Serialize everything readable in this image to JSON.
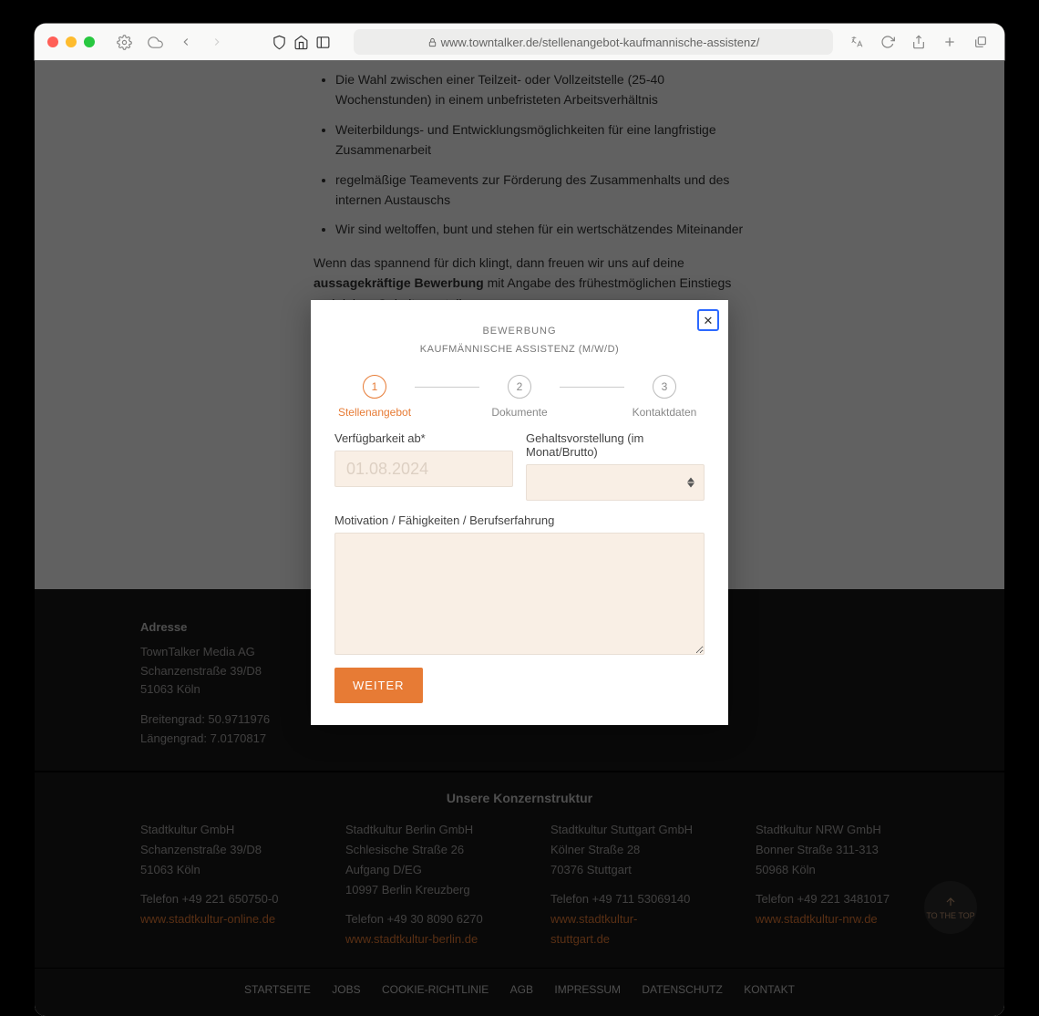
{
  "browser": {
    "url": "www.towntalker.de/stellenangebot-kaufmannische-assistenz/"
  },
  "job": {
    "bullets": [
      "Die Wahl zwischen einer Teilzeit- oder Vollzeitstelle (25-40 Wochenstunden) in einem unbefristeten Arbeitsverhältnis",
      "Weiterbildungs- und Entwicklungsmöglichkeiten für eine langfristige Zusammenarbeit",
      "regelmäßige Teamevents zur Förderung des Zusammenhalts und des internen Austauschs",
      "Wir sind weltoffen, bunt und stehen für ein wertschätzendes Miteinander"
    ],
    "trailing_lead": "Wenn das spannend für dich klingt, dann freuen wir uns auf deine ",
    "trailing_bold": "aussagekräftige Bewerbung",
    "trailing_rest": " mit Angabe des frühestmöglichen Einstiegs und deiner Gehaltsvorstellung."
  },
  "modal": {
    "title": "BEWERBUNG",
    "subtitle": "KAUFMÄNNISCHE ASSISTENZ (M/W/D)",
    "steps": [
      {
        "num": "1",
        "label": "Stellenangebot"
      },
      {
        "num": "2",
        "label": "Dokumente"
      },
      {
        "num": "3",
        "label": "Kontaktdaten"
      }
    ],
    "fields": {
      "availability_label": "Verfügbarkeit ab*",
      "availability_placeholder": "01.08.2024",
      "salary_label": "Gehaltsvorstellung (im Monat/Brutto)",
      "motivation_label": "Motivation / Fähigkeiten / Berufserfahrung"
    },
    "submit": "WEITER"
  },
  "footer": {
    "address_title": "Adresse",
    "company": "TownTalker Media AG",
    "street": "Schanzenstraße 39/D8",
    "city": "51063 Köln",
    "lat": "Breitengrad: 50.9711976",
    "lon": "Längengrad: 7.0170817",
    "konzern_title": "Unsere Konzernstruktur",
    "subs": [
      {
        "name": "Stadtkultur GmbH",
        "street": "Schanzenstraße 39/D8",
        "city": "51063 Köln",
        "phone": "Telefon +49 221 650750-0",
        "link": "www.stadtkultur-online.de"
      },
      {
        "name": "Stadtkultur Berlin GmbH",
        "street": "Schlesische Straße 26",
        "extra": "Aufgang D/EG",
        "city": "10997 Berlin Kreuzberg",
        "phone": "Telefon +49 30 8090 6270",
        "link": "www.stadtkultur-berlin.de"
      },
      {
        "name": "Stadtkultur Stuttgart GmbH",
        "street": "Kölner Straße 28",
        "city": "70376 Stuttgart",
        "phone": "Telefon +49 711 53069140",
        "link": "www.stadtkultur-stuttgart.de"
      },
      {
        "name": "Stadtkultur NRW GmbH",
        "street": "Bonner Straße 311-313",
        "city": "50968 Köln",
        "phone": "Telefon +49 221 3481017",
        "link": "www.stadtkultur-nrw.de"
      }
    ],
    "nav": [
      "STARTSEITE",
      "JOBS",
      "COOKIE-RICHTLINIE",
      "AGB",
      "IMPRESSUM",
      "DATENSCHUTZ",
      "KONTAKT"
    ],
    "scrolltop": "TO THE TOP"
  }
}
